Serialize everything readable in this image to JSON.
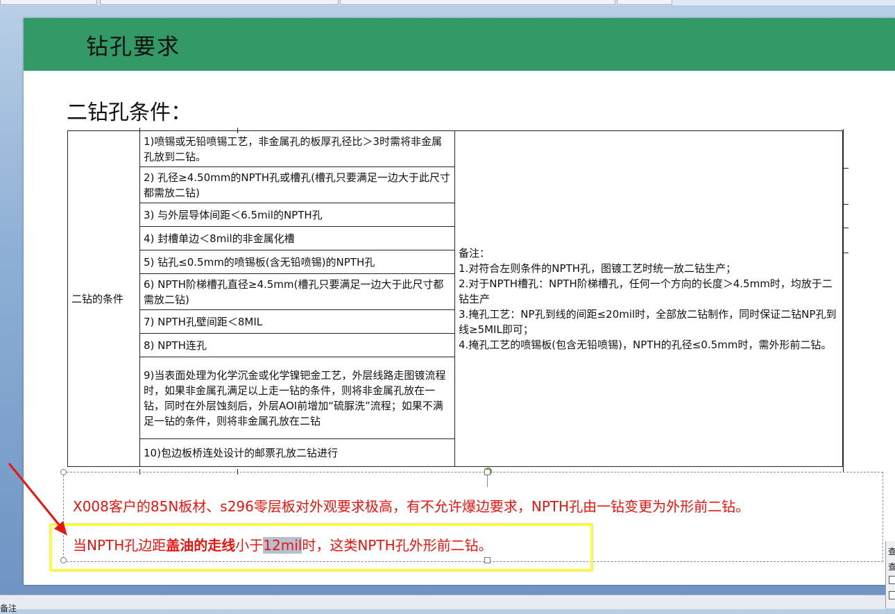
{
  "slide": {
    "title": "钻孔要求",
    "subtitle": "二钻孔条件："
  },
  "table": {
    "category": "二钻的条件",
    "items": [
      "1)喷锡或无铅喷锡工艺，非金属孔的板厚孔径比＞3时需将非金属孔放到二钻。",
      "2) 孔径≥4.50mm的NPTH孔或槽孔(槽孔只要满足一边大于此尺寸都需放二钻)",
      "3) 与外层导体间距＜6.5mil的NPTH孔",
      "4) 封槽单边＜8mil的非金属化槽",
      "5) 钻孔≤0.5mm的喷锡板(含无铅喷锡)的NPTH孔",
      "6) NPTH阶梯槽孔直径≥4.5mm(槽孔只要满足一边大于此尺寸都需放二钻)",
      "7) NPTH孔壁间距＜8MIL",
      "8) NPTH连孔",
      "9)当表面处理为化学沉金或化学镍钯金工艺，外层线路走图镀流程时，如果非金属孔满足以上走一钻的条件，则将非金属孔放在一钻，同时在外层蚀刻后，外层AOI前增加“硫脲洗”流程；如果不满足一钻的条件，则将非金属孔放在二钻",
      "10)包边板桥连处设计的邮票孔放二钻进行"
    ],
    "note": {
      "heading": "备注：",
      "lines": [
        "1.对符合左则条件的NPTH孔，图镀工艺时统一放二钻生产；",
        "2.对于NPTH槽孔：NPTH阶梯槽孔，任何一个方向的长度＞4.5mm时，均放于二钻生产",
        "3.掩孔工艺：NP孔到线的间距≤20mil时，全部放二钻制作，同时保证二钻NP孔到线≥5MIL即可；",
        "4.掩孔工艺的喷锡板(包含无铅喷锡)，NPTH的孔径≤0.5mm时，需外形前二钻。"
      ]
    }
  },
  "textbox": {
    "line1": "X008客户的85N板材、s296零层板对外观要求极高，有不允许爆边要求，NPTH孔由一钻变更为外形前二钻。",
    "line2_a": "当NPTH孔边距",
    "line2_bold": "盖油的走线",
    "line2_b": "小于",
    "line2_sel": "12mil",
    "line2_c": "时，这类NPTH孔外形前二钻。"
  },
  "side_panel": {
    "char1": "查",
    "char2": "查"
  },
  "status": {
    "label": "备注"
  },
  "colors": {
    "header_bg": "#339966",
    "annotation_red": "#e8140e",
    "highlight_box": "#ffff33"
  }
}
